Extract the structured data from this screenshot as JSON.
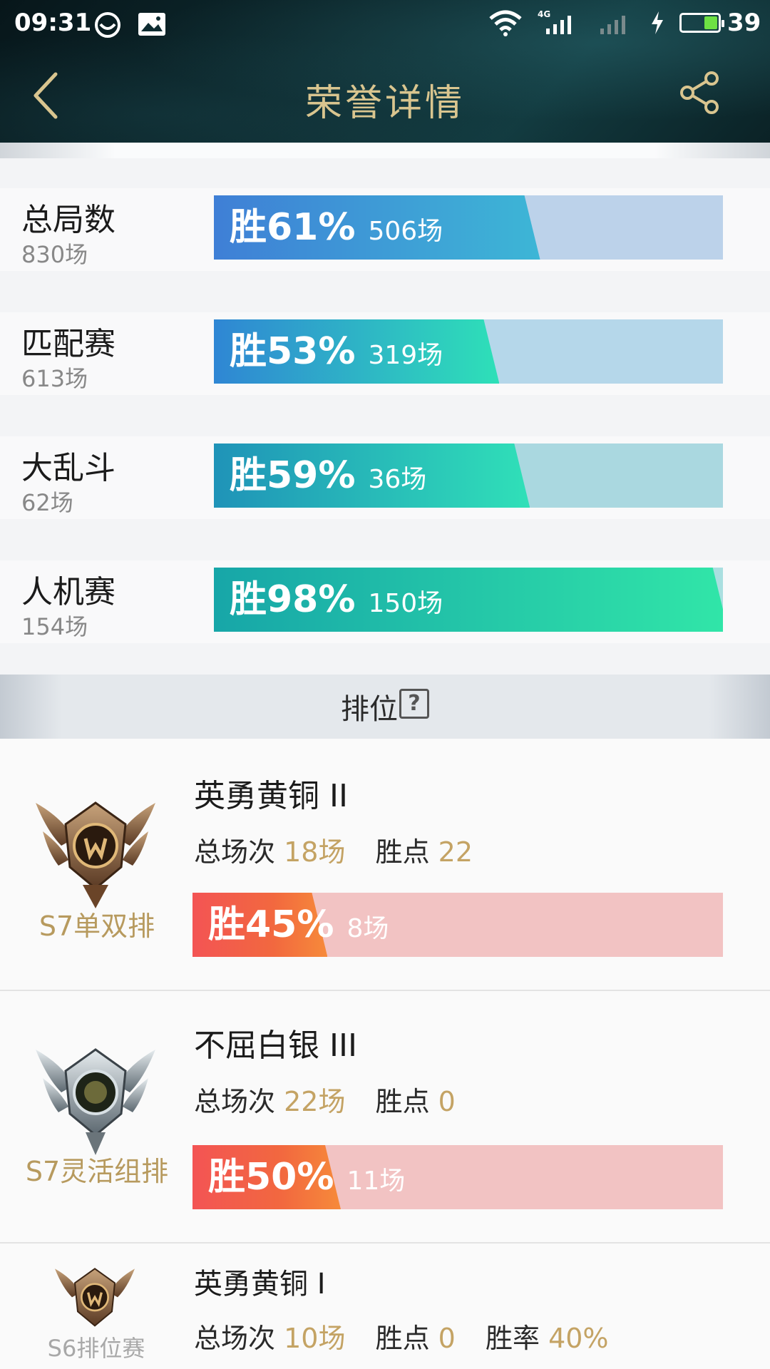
{
  "status_bar": {
    "time": "09:31",
    "network": "4G",
    "battery": "39"
  },
  "header": {
    "title": "荣誉详情"
  },
  "stats": [
    {
      "name": "总局数",
      "count": "830场",
      "win_pct": "胜61%",
      "wins": "506场",
      "fraction": 0.61,
      "gradient": [
        "#3f7fd6",
        "#3db6d6"
      ],
      "track": "#bcd2ea"
    },
    {
      "name": "匹配赛",
      "count": "613场",
      "win_pct": "胜53%",
      "wins": "319场",
      "fraction": 0.53,
      "gradient": [
        "#2f86d4",
        "#2ee0b8"
      ],
      "track": "#b5d7ea"
    },
    {
      "name": "大乱斗",
      "count": "62场",
      "win_pct": "胜59%",
      "wins": "36场",
      "fraction": 0.59,
      "gradient": [
        "#1f93b8",
        "#30e0b8"
      ],
      "track": "#aad8e0"
    },
    {
      "name": "人机赛",
      "count": "154场",
      "win_pct": "胜98%",
      "wins": "150场",
      "fraction": 0.98,
      "gradient": [
        "#17a6a8",
        "#31e6a8"
      ],
      "track": "#aadfe0"
    }
  ],
  "ranked": {
    "title": "排位",
    "help": "?",
    "cards": [
      {
        "season": "S7单双排",
        "tier": "英勇黄铜 II",
        "total_label": "总场次",
        "total": "18场",
        "points_label": "胜点",
        "points": "22",
        "win_pct": "胜45%",
        "wins": "8场",
        "fraction": 0.45,
        "emblem": "bronze-emblem"
      },
      {
        "season": "S7灵活组排",
        "tier": "不屈白银 III",
        "total_label": "总场次",
        "total": "22场",
        "points_label": "胜点",
        "points": "0",
        "win_pct": "胜50%",
        "wins": "11场",
        "fraction": 0.5,
        "emblem": "silver-emblem"
      },
      {
        "season": "S6排位赛",
        "tier": "英勇黄铜 I",
        "total_label": "总场次",
        "total": "10场",
        "points_label": "胜点",
        "points": "0",
        "rate_label": "胜率",
        "rate": "40%",
        "emblem": "bronze-emblem"
      }
    ]
  }
}
